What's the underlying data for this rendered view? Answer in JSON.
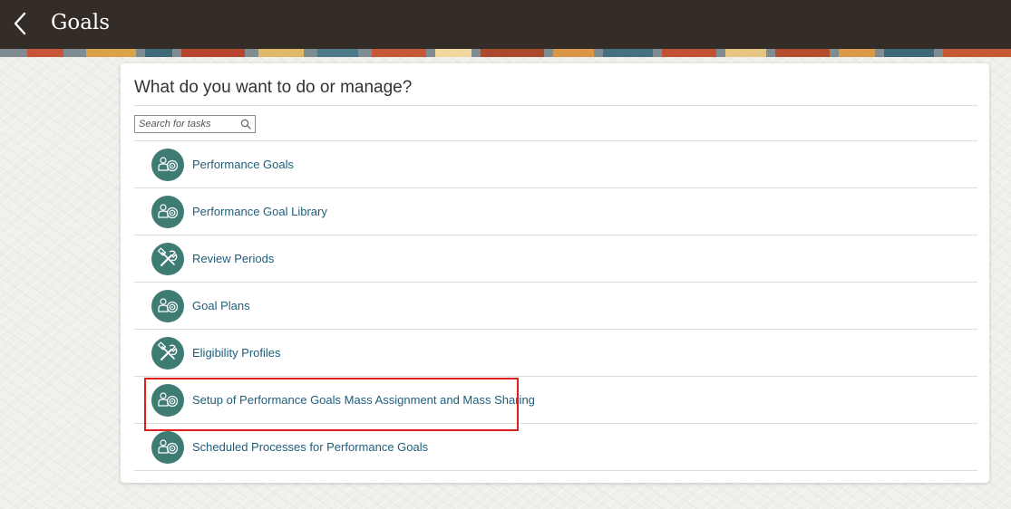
{
  "header": {
    "title": "Goals",
    "back_icon": "chevron-left-icon",
    "background_color": "#332c27"
  },
  "main": {
    "heading": "What do you want to do or manage?",
    "search": {
      "placeholder": "Search for tasks",
      "value": "",
      "icon": "search-icon"
    },
    "tasks": [
      {
        "label": "Performance Goals",
        "icon": "goals-target-icon"
      },
      {
        "label": "Performance Goal Library",
        "icon": "goals-target-icon"
      },
      {
        "label": "Review Periods",
        "icon": "tools-wrench-hammer-icon"
      },
      {
        "label": "Goal Plans",
        "icon": "goals-target-icon"
      },
      {
        "label": "Eligibility Profiles",
        "icon": "tools-wrench-hammer-icon"
      },
      {
        "label": "Setup of Performance Goals Mass Assignment and Mass Sharing",
        "icon": "goals-target-icon",
        "highlighted": true
      },
      {
        "label": "Scheduled Processes for Performance Goals",
        "icon": "goals-target-icon"
      }
    ]
  },
  "colors": {
    "icon_background": "#3d7b73",
    "link_text": "#1f5d7a",
    "highlight_border": "#e01e1e"
  }
}
